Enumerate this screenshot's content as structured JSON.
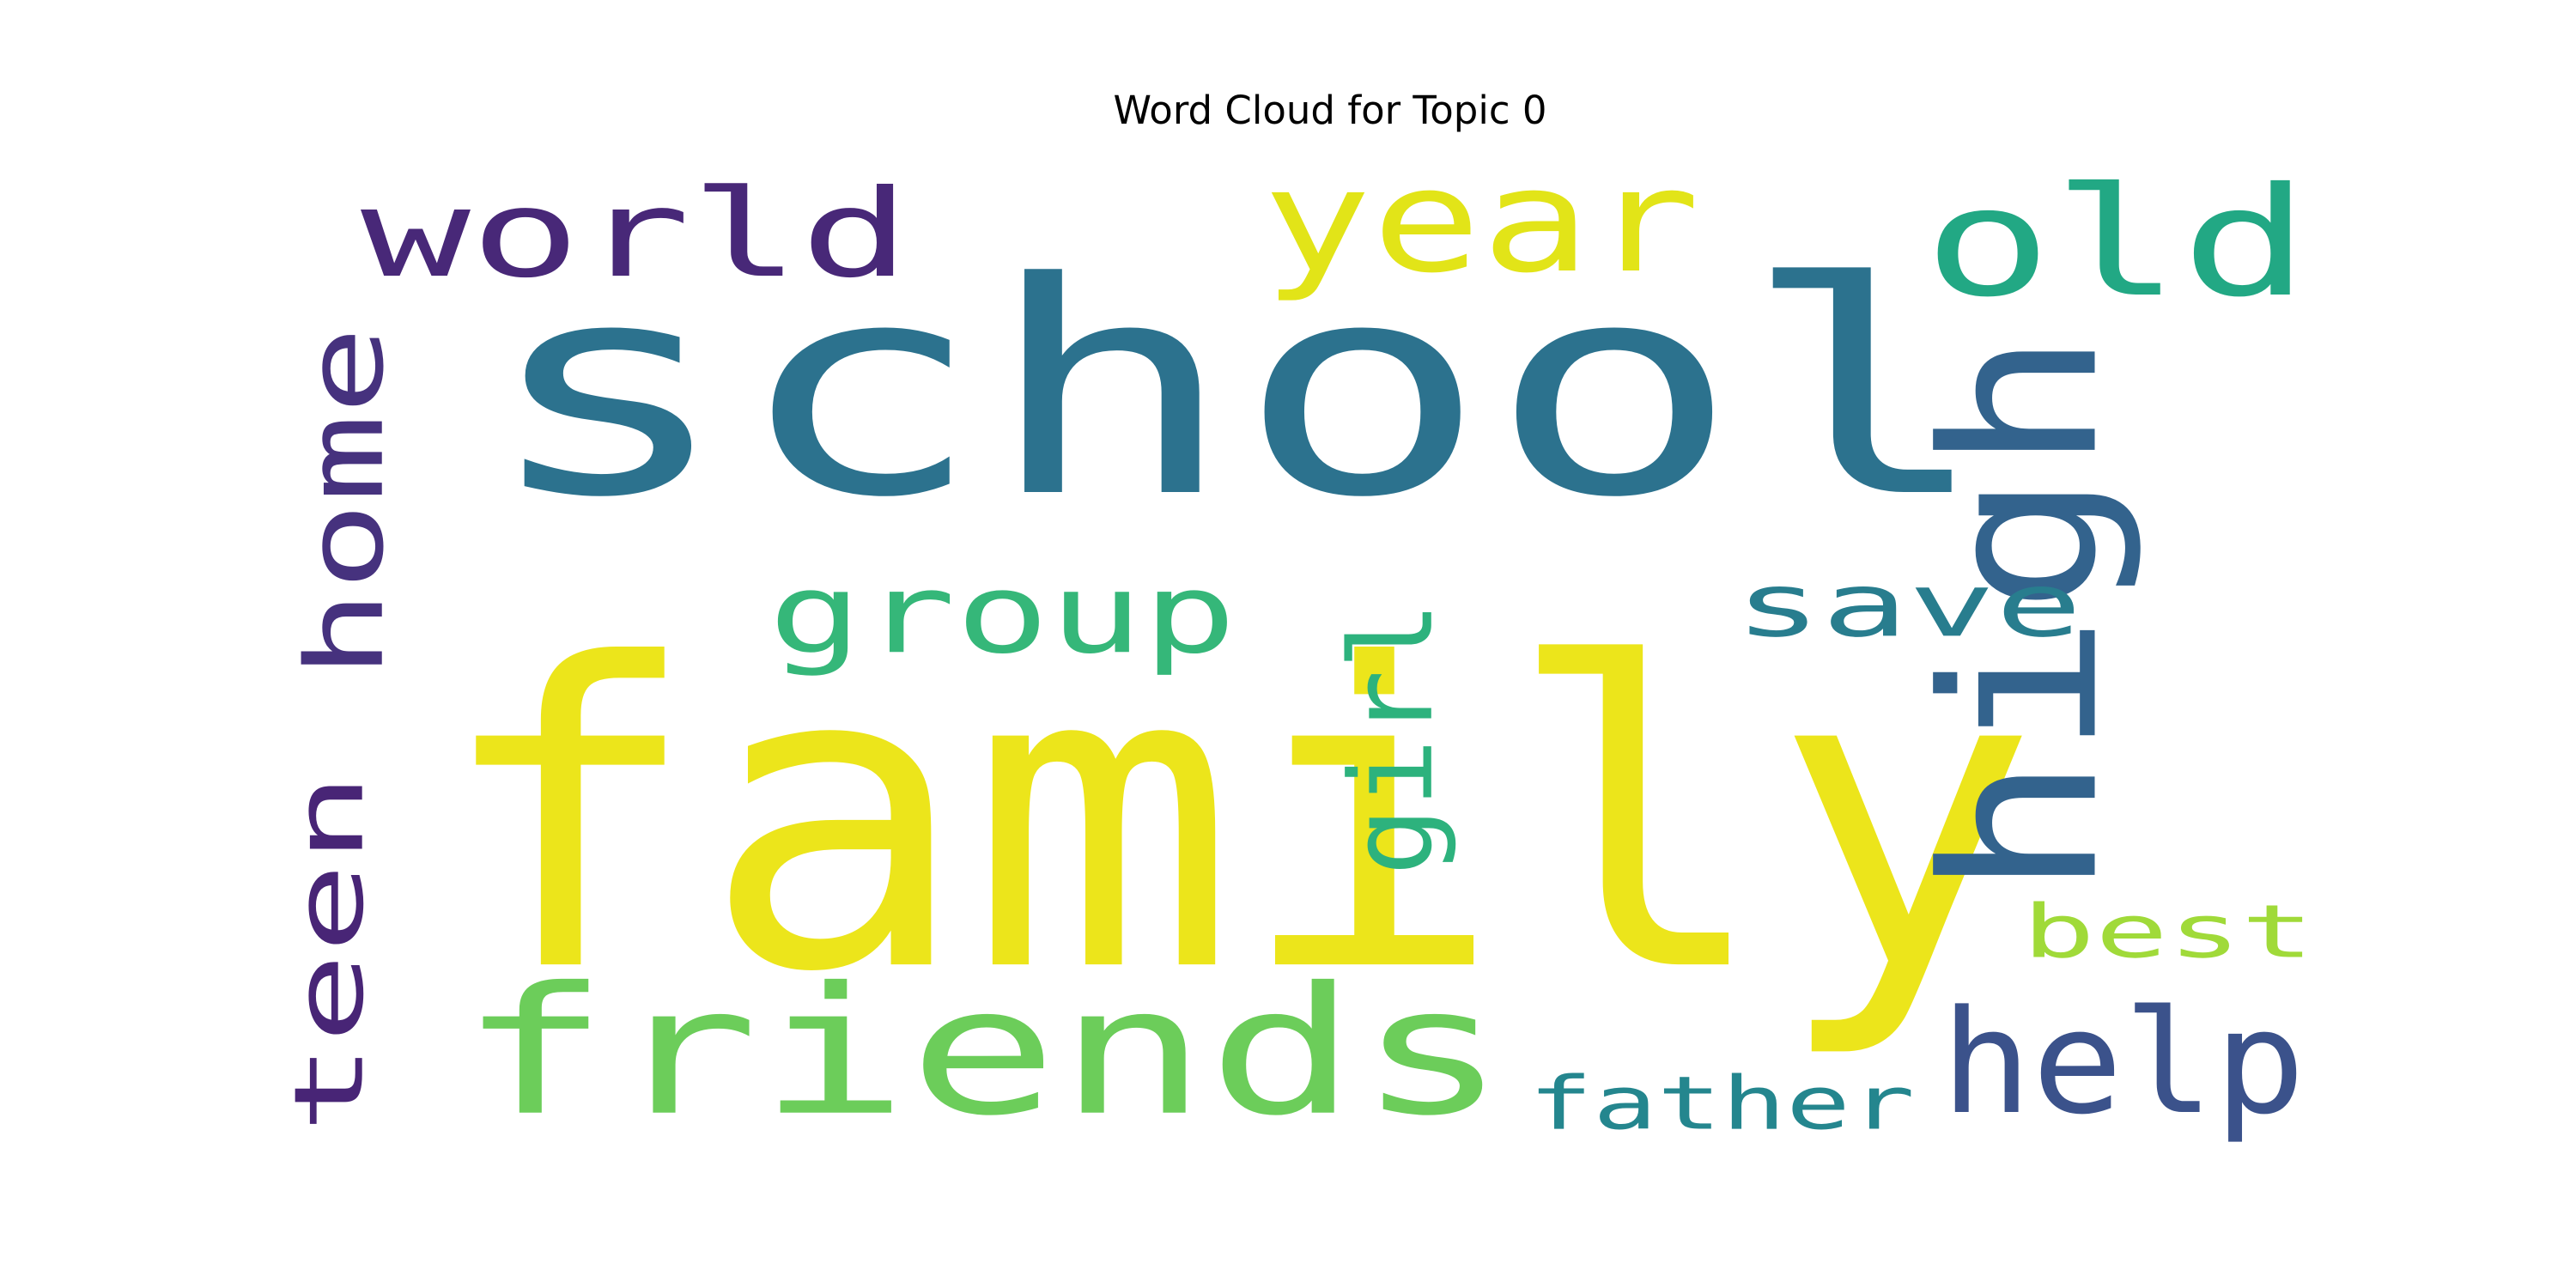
{
  "chart_data": {
    "type": "wordcloud",
    "title": "Word Cloud for Topic 0",
    "background": "#ffffff",
    "words": [
      {
        "text": "school",
        "color": "#2c728e",
        "rotated": false
      },
      {
        "text": "family",
        "color": "#ece51b",
        "rotated": false
      },
      {
        "text": "friends",
        "color": "#6ccd5a",
        "rotated": false
      },
      {
        "text": "world",
        "color": "#482878",
        "rotated": false
      },
      {
        "text": "year",
        "color": "#e2e418",
        "rotated": false
      },
      {
        "text": "old",
        "color": "#22a884",
        "rotated": false
      },
      {
        "text": "high",
        "color": "#33638d",
        "rotated": true
      },
      {
        "text": "home",
        "color": "#46327e",
        "rotated": true
      },
      {
        "text": "group",
        "color": "#35b779",
        "rotated": false
      },
      {
        "text": "save",
        "color": "#287d8e",
        "rotated": false
      },
      {
        "text": "girl",
        "color": "#2db27d",
        "rotated": true
      },
      {
        "text": "teen",
        "color": "#482576",
        "rotated": true
      },
      {
        "text": "best",
        "color": "#a0da39",
        "rotated": false
      },
      {
        "text": "help",
        "color": "#3b528b",
        "rotated": false
      },
      {
        "text": "father",
        "color": "#24868e",
        "rotated": false
      }
    ]
  }
}
